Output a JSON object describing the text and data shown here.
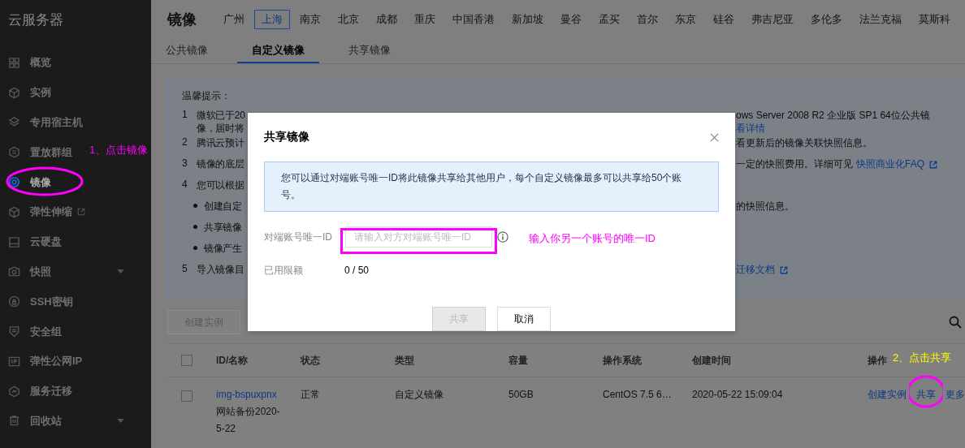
{
  "sidebar": {
    "title": "云服务器",
    "items": [
      {
        "label": "概览",
        "selected": false,
        "external": false,
        "submenu": false
      },
      {
        "label": "实例",
        "selected": false,
        "external": false,
        "submenu": false
      },
      {
        "label": "专用宿主机",
        "selected": false,
        "external": false,
        "submenu": false
      },
      {
        "label": "置放群组",
        "selected": false,
        "external": false,
        "submenu": false
      },
      {
        "label": "镜像",
        "selected": true,
        "external": false,
        "submenu": false
      },
      {
        "label": "弹性伸缩",
        "selected": false,
        "external": true,
        "submenu": false
      },
      {
        "label": "云硬盘",
        "selected": false,
        "external": false,
        "submenu": false
      },
      {
        "label": "快照",
        "selected": false,
        "external": false,
        "submenu": true
      },
      {
        "label": "SSH密钥",
        "selected": false,
        "external": false,
        "submenu": false
      },
      {
        "label": "安全组",
        "selected": false,
        "external": false,
        "submenu": false
      },
      {
        "label": "弹性公网IP",
        "selected": false,
        "external": false,
        "submenu": false
      },
      {
        "label": "服务迁移",
        "selected": false,
        "external": false,
        "submenu": false
      },
      {
        "label": "回收站",
        "selected": false,
        "external": false,
        "submenu": true
      }
    ]
  },
  "header": {
    "title": "镜像",
    "regions": [
      {
        "label": "广州",
        "selected": false
      },
      {
        "label": "上海",
        "selected": true
      },
      {
        "label": "南京",
        "selected": false
      },
      {
        "label": "北京",
        "selected": false
      },
      {
        "label": "成都",
        "selected": false
      },
      {
        "label": "重庆",
        "selected": false
      },
      {
        "label": "中国香港",
        "selected": false
      },
      {
        "label": "新加坡",
        "selected": false
      },
      {
        "label": "曼谷",
        "selected": false
      },
      {
        "label": "孟买",
        "selected": false
      },
      {
        "label": "首尔",
        "selected": false
      },
      {
        "label": "东京",
        "selected": false
      },
      {
        "label": "硅谷",
        "selected": false
      },
      {
        "label": "弗吉尼亚",
        "selected": false
      },
      {
        "label": "多伦多",
        "selected": false
      },
      {
        "label": "法兰克福",
        "selected": false
      },
      {
        "label": "莫斯科",
        "selected": false
      }
    ]
  },
  "subtabs": [
    {
      "label": "公共镜像",
      "selected": false
    },
    {
      "label": "自定义镜像",
      "selected": true
    },
    {
      "label": "共享镜像",
      "selected": false
    }
  ],
  "notice": {
    "title": "温馨提示：",
    "rows": [
      {
        "kind": "numbered",
        "number": "1",
        "left": "微软已于20",
        "right": [
          {
            "kind": "text",
            "text": "ows Server 2008 R2 企业版 SP1 64位公共镜"
          }
        ]
      },
      {
        "kind": "continuation",
        "left": "像，届时将",
        "right": [
          {
            "kind": "link",
            "text": "看详情"
          }
        ]
      },
      {
        "kind": "numbered",
        "number": "2",
        "left": "腾讯云预计",
        "right": [
          {
            "kind": "text",
            "text": "看更新后的镜像关联快照信息。"
          }
        ]
      },
      {
        "kind": "numbered",
        "number": "3",
        "left": "镜像的底层",
        "right": [
          {
            "kind": "text",
            "text": "一定的快照费用。详细可见"
          },
          {
            "kind": "external_link",
            "text": "快照商业化FAQ"
          }
        ]
      },
      {
        "kind": "numbered",
        "number": "4",
        "left": "您可以根据",
        "right": []
      },
      {
        "kind": "bullet",
        "left": "创建自定",
        "right": [
          {
            "kind": "text",
            "text": "的快照信息。"
          }
        ]
      },
      {
        "kind": "bullet",
        "left": "共享镜像",
        "right": []
      },
      {
        "kind": "bullet",
        "left": "镜像产生",
        "right": []
      },
      {
        "kind": "numbered",
        "number": "5",
        "left": "导入镜像目",
        "right": [
          {
            "kind": "external_link",
            "text": "迁移文档"
          }
        ]
      }
    ]
  },
  "toolbar": {
    "create_button": {
      "label": "创建实例",
      "disabled": true
    }
  },
  "table": {
    "header_checked": false,
    "columns": [
      "ID/名称",
      "状态",
      "类型",
      "容量",
      "操作系统",
      "创建时间",
      "操作"
    ],
    "rows": [
      {
        "checked": false,
        "id": "img-bspuxpnx",
        "name": "网站备份2020-5-22",
        "status": "正常",
        "type": "自定义镜像",
        "capacity": "50GB",
        "os": "CentOS 7.5 6…",
        "created": "2020-05-22 15:09:04",
        "actions": [
          "创建实例",
          "共享",
          "更多"
        ]
      }
    ]
  },
  "dialog": {
    "title": "共享镜像",
    "info": "您可以通过对端账号唯一ID将此镜像共享给其他用户，每个自定义镜像最多可以共享给50个账号。",
    "field_label": "对端账号唯一ID",
    "placeholder": "请输入对方对端账号唯一ID",
    "quota_label": "已用限额",
    "quota_value": "0 / 50",
    "buttons": [
      {
        "label": "共享",
        "disabled": true
      },
      {
        "label": "取消",
        "disabled": false
      }
    ]
  },
  "annotations": [
    {
      "text": "1、点击镜像",
      "color": "#ff00ff"
    },
    {
      "text": "输入你另一个账号的唯一ID",
      "color": "#ff00ff"
    },
    {
      "text": "2、点击共享",
      "color": "#ffff00"
    }
  ]
}
